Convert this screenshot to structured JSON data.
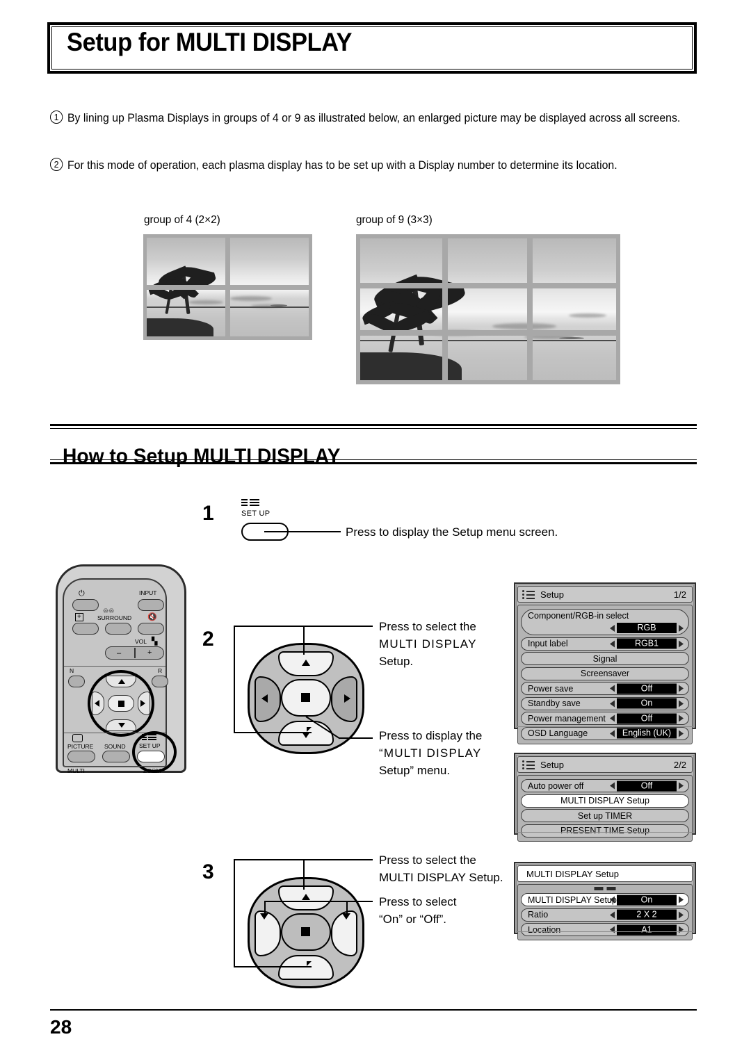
{
  "page": {
    "title": "Setup for MULTI DISPLAY",
    "section_heading": "How to Setup MULTI DISPLAY",
    "page_number": "28"
  },
  "intro": {
    "item1_marker": "1",
    "item1_text": "By lining up Plasma Displays in groups of 4 or 9 as illustrated below, an enlarged picture may be displayed across all screens.",
    "item2_marker": "2",
    "item2_text": "For this mode of operation, each plasma display has to be set up with a Display number to determine its location."
  },
  "figures": {
    "group4_caption": "group of 4 (2×2)",
    "group9_caption": "group of 9 (3×3)"
  },
  "steps": {
    "step1": {
      "number": "1",
      "key_label": "SET UP",
      "callout": "Press to display the Setup menu screen."
    },
    "step2": {
      "number": "2",
      "callout_up": "Press to select the",
      "callout_up_emphasis": "MULTI  DISPLAY",
      "callout_up_tail": "Setup.",
      "callout_center": "Press to display the",
      "callout_center_emphasis": "“MULTI  DISPLAY",
      "callout_center_tail": "Setup” menu."
    },
    "step3": {
      "number": "3",
      "callout_up_line1": "Press to select the",
      "callout_up_line2": "MULTI DISPLAY Setup.",
      "callout_lr_line1": "Press to select",
      "callout_lr_line2": "“On” or “Off”."
    }
  },
  "remote": {
    "labels": {
      "power": "⏻",
      "input": "INPUT",
      "surround": "SURROUND",
      "mute": "mute-icon",
      "vol": "VOL",
      "n": "N",
      "r": "R",
      "picture": "PICTURE",
      "sound": "SOUND",
      "setup": "SET UP",
      "multi": "MULTI",
      "zoom": "ZOOM",
      "vol_minus": "–",
      "vol_plus": "+"
    }
  },
  "osd": {
    "setup1": {
      "title": "Setup",
      "page": "1/2",
      "rows": [
        {
          "label": "Component/RGB-in  select",
          "value": "RGB",
          "type": "value-below"
        },
        {
          "label": "Input label",
          "value": "RGB1",
          "type": "value"
        },
        {
          "label": "Signal",
          "type": "plain"
        },
        {
          "label": "Screensaver",
          "type": "plain"
        },
        {
          "label": "Power save",
          "value": "Off",
          "type": "value"
        },
        {
          "label": "Standby save",
          "value": "On",
          "type": "value"
        },
        {
          "label": "Power management",
          "value": "Off",
          "type": "value"
        },
        {
          "label": "OSD  Language",
          "value": "English (UK)",
          "type": "value"
        }
      ]
    },
    "setup2": {
      "title": "Setup",
      "page": "2/2",
      "rows": [
        {
          "label": "Auto power off",
          "value": "Off",
          "type": "value"
        },
        {
          "label": "MULTI DISPLAY Setup",
          "type": "plain-highlight"
        },
        {
          "label": "Set up TIMER",
          "type": "plain"
        },
        {
          "label": "PRESENT  TIME  Setup",
          "type": "plain"
        }
      ]
    },
    "multi": {
      "title": "MULTI DISPLAY Setup",
      "rows": [
        {
          "label": "MULTI DISPLAY Setup",
          "value": "On",
          "type": "value-highlight"
        },
        {
          "label": "Ratio",
          "value": "2 X 2",
          "type": "value"
        },
        {
          "label": "Location",
          "value": "A1",
          "type": "value"
        }
      ]
    }
  }
}
